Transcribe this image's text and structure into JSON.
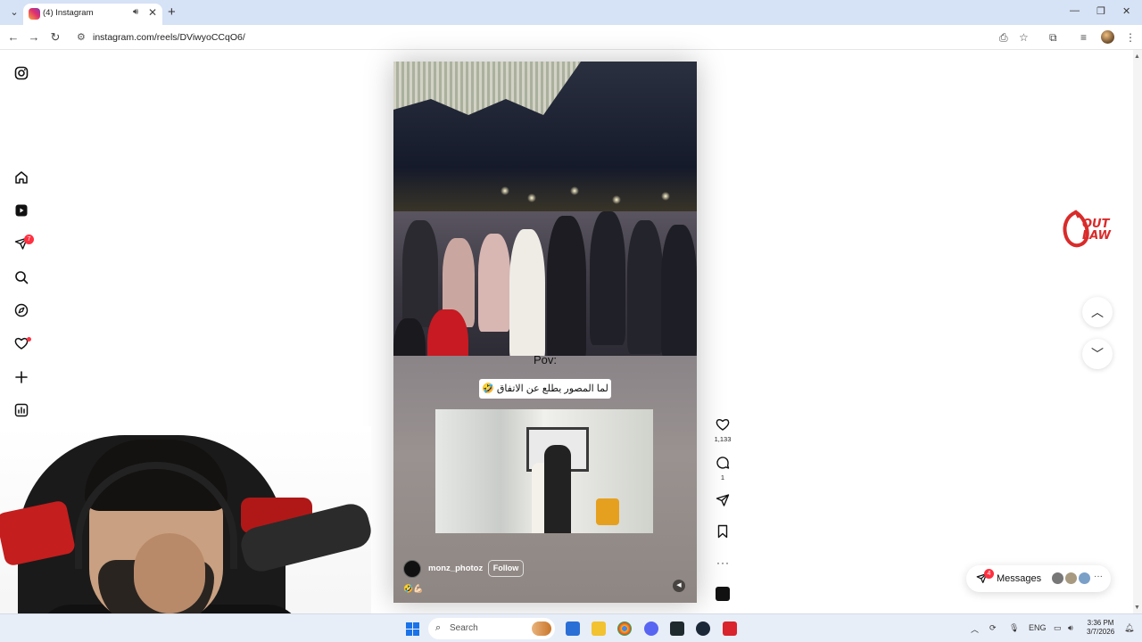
{
  "browser": {
    "tab_title": "(4) Instagram",
    "url": "instagram.com/reels/DViwyoCCqO6/",
    "new_tab_glyph": "+",
    "tab_close_glyph": "✕"
  },
  "nav": {
    "items": [
      {
        "name": "instagram-logo-icon"
      },
      {
        "name": "home-icon"
      },
      {
        "name": "reels-icon"
      },
      {
        "name": "messages-icon",
        "badge": "7"
      },
      {
        "name": "search-icon"
      },
      {
        "name": "explore-icon"
      },
      {
        "name": "notifications-icon"
      },
      {
        "name": "create-icon"
      },
      {
        "name": "dashboard-icon"
      },
      {
        "name": "profile-avatar"
      }
    ],
    "messages_badge": "7"
  },
  "reel": {
    "overlay_title": "Pov:",
    "caption": "لما المصور يطلع عن الاتفاق 🤣",
    "author": "monz_photoz",
    "follow_label": "Follow",
    "emojis": "🤣💪🏻",
    "mute_icon": "speaker-icon"
  },
  "actions": {
    "like_count": "1,133",
    "comment_count": "1",
    "more_glyph": "···"
  },
  "watermark": {
    "line1": "OUT",
    "line2": "LAW",
    "color": "#d92b2b"
  },
  "messages": {
    "label": "Messages",
    "badge": "4",
    "more_glyph": "···"
  },
  "taskbar": {
    "search_label": "Search",
    "language": "ENG",
    "time": "3:36 PM",
    "date": "3/7/2026"
  },
  "colors": {
    "accent": "#ff3040",
    "taskbar_bg": "#e8eef8",
    "tab_strip": "#d6e2f5"
  }
}
